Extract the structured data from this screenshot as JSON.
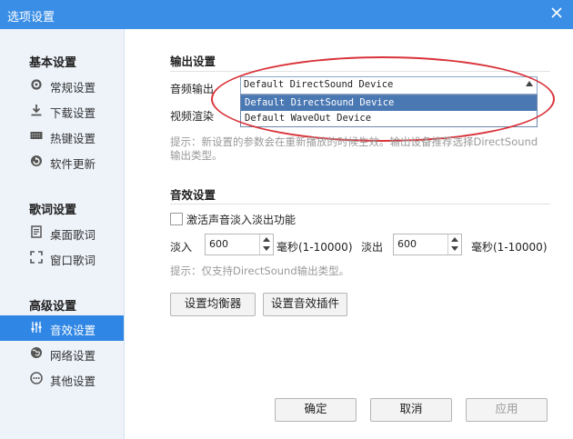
{
  "window": {
    "title": "选项设置"
  },
  "sidebar": {
    "groups": [
      {
        "title": "基本设置",
        "items": [
          {
            "label": "常规设置",
            "icon": "gear-icon"
          },
          {
            "label": "下载设置",
            "icon": "download-icon"
          },
          {
            "label": "热键设置",
            "icon": "keyboard-icon"
          },
          {
            "label": "软件更新",
            "icon": "update-icon"
          }
        ]
      },
      {
        "title": "歌词设置",
        "items": [
          {
            "label": "桌面歌词",
            "icon": "desktop-lyrics-icon"
          },
          {
            "label": "窗口歌词",
            "icon": "window-lyrics-icon"
          }
        ]
      },
      {
        "title": "高级设置",
        "items": [
          {
            "label": "音效设置",
            "icon": "equalizer-icon",
            "active": true
          },
          {
            "label": "网络设置",
            "icon": "network-icon"
          },
          {
            "label": "其他设置",
            "icon": "more-icon"
          }
        ]
      }
    ]
  },
  "output": {
    "section_title": "输出设置",
    "audio_label": "音频输出",
    "video_label": "视频渲染",
    "audio_value": "Default DirectSound Device",
    "options": [
      "Default DirectSound Device",
      "Default WaveOut Device"
    ],
    "hint_line1": "提示：新设置的参数会在重新播放的时候生效。输出设备推荐选择DirectSound",
    "hint_line2": "输出类型。"
  },
  "effects": {
    "section_title": "音效设置",
    "fade_checkbox_label": "激活声音淡入淡出功能",
    "fade_in_label": "淡入",
    "fade_in_value": "600",
    "fade_in_unit": "毫秒(1-10000)",
    "fade_out_label": "淡出",
    "fade_out_value": "600",
    "fade_out_unit": "毫秒(1-10000)",
    "hint": "提示：仅支持DirectSound输出类型。",
    "equalizer_button": "设置均衡器",
    "plugin_button": "设置音效插件"
  },
  "footer": {
    "ok": "确定",
    "cancel": "取消",
    "apply": "应用"
  },
  "colors": {
    "titlebar": "#3a8ee6",
    "sidebar_active": "#2f86e4",
    "highlight_ellipse": "#d9333a",
    "dropdown_selected": "#4a78b3"
  }
}
